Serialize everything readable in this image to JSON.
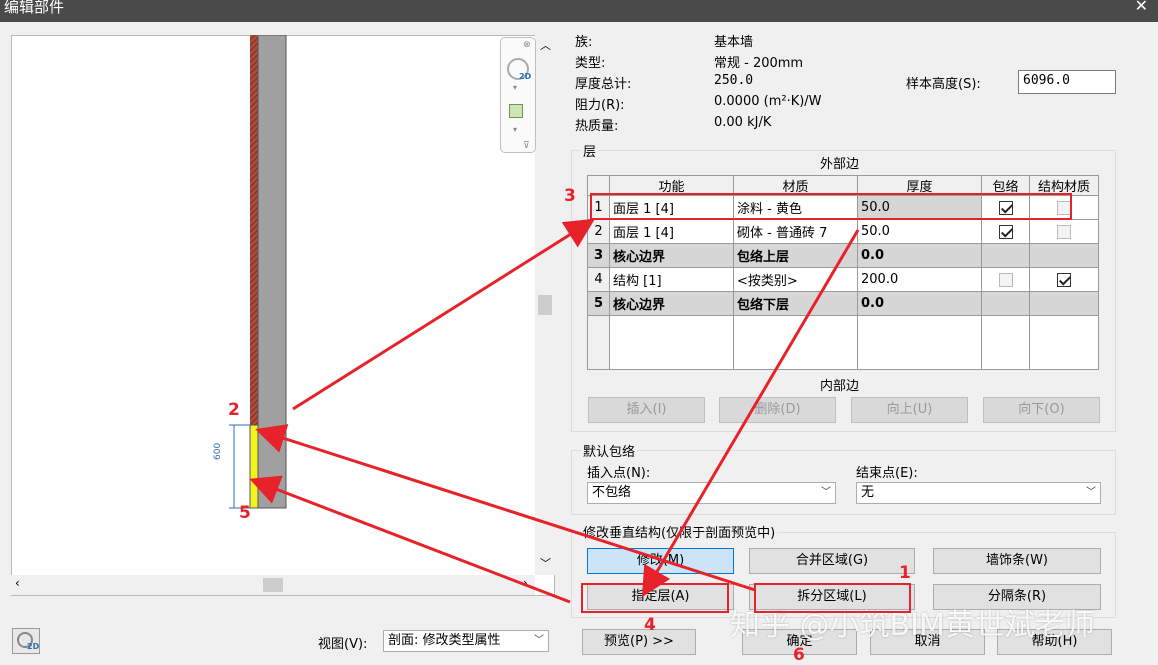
{
  "window": {
    "title": "编辑部件",
    "close": "✕"
  },
  "info": {
    "family_label": "族:",
    "family_value": "基本墙",
    "type_label": "类型:",
    "type_value": "常规 - 200mm",
    "thickness_label": "厚度总计:",
    "thickness_value": "250.0",
    "resistance_label": "阻力(R):",
    "resistance_value": "0.0000 (m²·K)/W",
    "thermal_label": "热质量:",
    "thermal_value": "0.00 kJ/K",
    "sample_height_label": "样本高度(S):",
    "sample_height_value": "6096.0"
  },
  "layers": {
    "group_label": "层",
    "exterior_label": "外部边",
    "interior_label": "内部边",
    "headers": [
      "功能",
      "材质",
      "厚度",
      "包络",
      "结构材质"
    ],
    "rows": [
      {
        "num": "1",
        "function": "面层 1 [4]",
        "material": "涂料 - 黄色",
        "thickness": "50.0",
        "wrap": true,
        "structural": false
      },
      {
        "num": "2",
        "function": "面层 1 [4]",
        "material": "砌体 - 普通砖 7",
        "thickness": "50.0",
        "wrap": true,
        "structural": false
      },
      {
        "num": "3",
        "function": "核心边界",
        "material": "包络上层",
        "thickness": "0.0"
      },
      {
        "num": "4",
        "function": "结构 [1]",
        "material": "<按类别>",
        "thickness": "200.0",
        "wrap": false,
        "structural": true
      },
      {
        "num": "5",
        "function": "核心边界",
        "material": "包络下层",
        "thickness": "0.0"
      }
    ],
    "buttons": {
      "insert": "插入(I)",
      "delete": "删除(D)",
      "up": "向上(U)",
      "down": "向下(O)"
    }
  },
  "wrapping": {
    "group_label": "默认包络",
    "insert_label": "插入点(N):",
    "insert_value": "不包络",
    "end_label": "结束点(E):",
    "end_value": "无"
  },
  "vertical": {
    "group_label": "修改垂直结构(仅限于剖面预览中)",
    "modify": "修改(M)",
    "merge": "合并区域(G)",
    "sweeps": "墙饰条(W)",
    "assign": "指定层(A)",
    "split": "拆分区域(L)",
    "reveals": "分隔条(R)"
  },
  "footer": {
    "view_label": "视图(V):",
    "view_value": "剖面: 修改类型属性",
    "preview": "预览(P) >>",
    "ok": "确定",
    "cancel": "取消",
    "help": "帮助(H)"
  },
  "preview": {
    "dimension": "600"
  },
  "annotations": {
    "n1": "1",
    "n2": "2",
    "n3": "3",
    "n4": "4",
    "n5": "5",
    "n6": "6"
  },
  "watermark": "知乎 @小筑BIM黄世斌老师",
  "colors": {
    "annotation": "#e8222a",
    "yellow_layer": "#f2f21e",
    "wall_core": "#a0a0a0"
  }
}
